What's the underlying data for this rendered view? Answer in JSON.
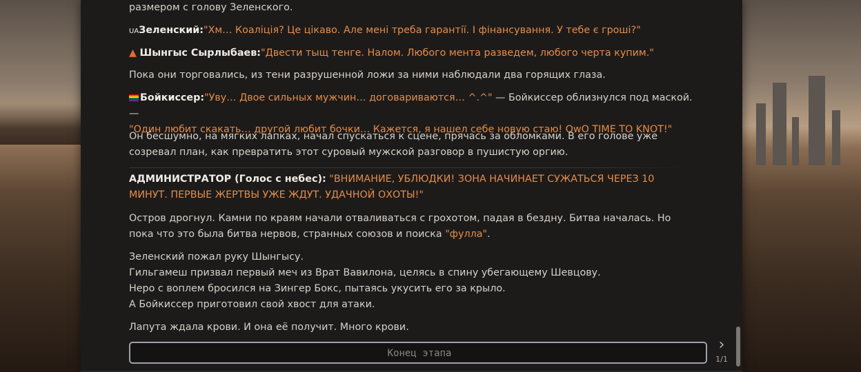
{
  "story": {
    "line0": "размером с голову Зеленского.",
    "zelensky": {
      "icon_text": "UA",
      "name": "Зеленский:",
      "quote": "\"Хм… Коаліція? Це цікаво. Але мені треба гарантії. І фінансування. У тебе є гроші?\""
    },
    "shyngys": {
      "name": "Шынгыс Сырлыбаев:",
      "quote": "\"Двести тыщ тенге. Налом. Любого мента разведем, любого черта купим.\""
    },
    "para1": "Пока они торговались, из тени разрушенной ложи за ними наблюдали два горящих глаза.",
    "boykisser": {
      "name": "Бойкиссер:",
      "quote1": "\"Уву… Двое сильных мужчин… договариваются… ^.^\"",
      "narration": " — Бойкиссер облизнулся под маской. — ",
      "quote2": "\"Один любит скакать… другой любит бочки… Кажется, я нашел себе новую стаю! OwO TIME TO KNOT!\""
    },
    "para2": "Он бесшумно, на мягких лапках, начал спускаться к сцене, прячась за обломками. В его голове уже созревал план, как превратить этот суровый мужской разговор в пушистую оргию.",
    "admin": {
      "name": "АДМИНИСТРАТОР (Голос с небес):",
      "quote": "\"ВНИМАНИЕ, УБЛЮДКИ! ЗОНА НАЧИНАЕТ СУЖАТЬСЯ ЧЕРЕЗ 10 МИНУТ. ПЕРВЫЕ ЖЕРТВЫ УЖЕ ЖДУТ. УДАЧНОЙ ОХОТЫ!\""
    },
    "para3_a": "Остров дрогнул. Камни по краям начали отваливаться с грохотом, падая в бездну. Битва началась. Но пока что это была битва нервов, странных союзов и поиска ",
    "para3_b": "\"фулла\"",
    "para3_c": ".",
    "para4": [
      "Зеленский пожал руку Шынгысу.",
      "Гильгамеш призвал первый меч из Врат Вавилона, целясь в спину убегающему Шевцову.",
      "Неро с воплем бросился на Зингер Бокс, пытаясь укусить его за крыло.",
      "А Бойкиссер приготовил свой хвост для атаки."
    ],
    "para5": "Лапута ждала крови. И она её получит. Много крови."
  },
  "input": {
    "placeholder": "Конец этапа",
    "value": ""
  },
  "controls": {
    "next_icon": "chevron-right-icon",
    "next_glyph": "›",
    "page_indicator": "1/1"
  },
  "colors": {
    "panel_bg": "#1d1b1a",
    "body_text": "#d6d1cb",
    "speech": "#e58d4a",
    "name": "#f0ece6",
    "input_border": "#9aa3b0"
  }
}
